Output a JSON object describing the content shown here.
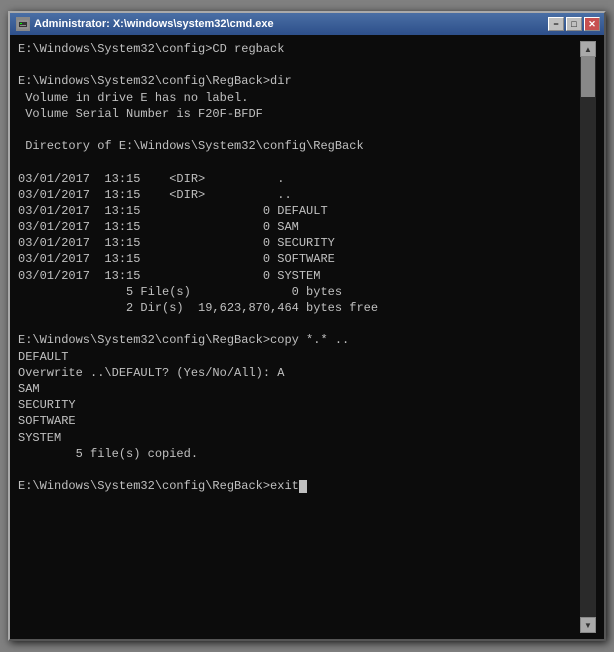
{
  "window": {
    "title": "Administrator: X:\\windows\\system32\\cmd.exe",
    "icon_label": "C:\\",
    "min_button": "−",
    "max_button": "□",
    "close_button": "✕"
  },
  "console": {
    "lines": [
      "",
      "E:\\Windows\\System32\\config>CD regback",
      "",
      "E:\\Windows\\System32\\config\\RegBack>dir",
      " Volume in drive E has no label.",
      " Volume Serial Number is F20F-BFDF",
      "",
      " Directory of E:\\Windows\\System32\\config\\RegBack",
      "",
      "03/01/2017  13:15    <DIR>          .",
      "03/01/2017  13:15    <DIR>          ..",
      "03/01/2017  13:15                 0 DEFAULT",
      "03/01/2017  13:15                 0 SAM",
      "03/01/2017  13:15                 0 SECURITY",
      "03/01/2017  13:15                 0 SOFTWARE",
      "03/01/2017  13:15                 0 SYSTEM",
      "               5 File(s)              0 bytes",
      "               2 Dir(s)  19,623,870,464 bytes free",
      "",
      "E:\\Windows\\System32\\config\\RegBack>copy *.* ..",
      "DEFAULT",
      "Overwrite ..\\DEFAULT? (Yes/No/All): A",
      "SAM",
      "SECURITY",
      "SOFTWARE",
      "SYSTEM",
      "        5 file(s) copied.",
      "",
      "E:\\Windows\\System32\\config\\RegBack>exit"
    ],
    "prompt_cursor": true
  },
  "colors": {
    "background": "#0c0c0c",
    "text": "#c0c0c0",
    "title_bar_start": "#4a6fa5",
    "title_bar_end": "#2d4f8a"
  }
}
